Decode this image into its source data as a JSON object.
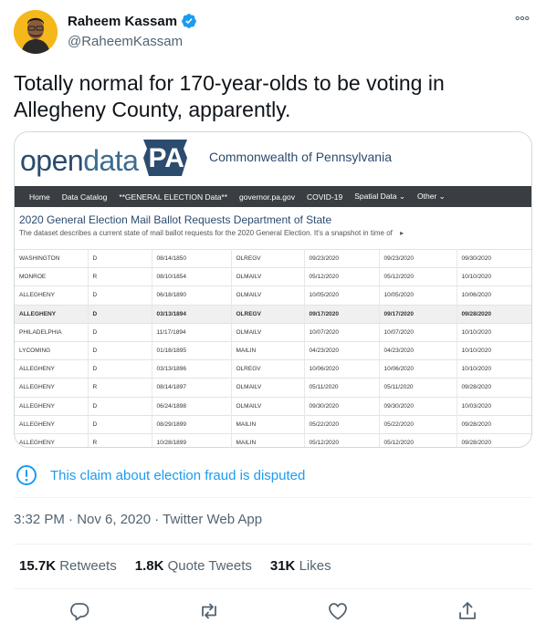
{
  "author": {
    "display_name": "Raheem Kassam",
    "handle": "@RaheemKassam"
  },
  "tweet": {
    "text": "Totally normal for 170-year-olds to be voting in Allegheny County, apparently."
  },
  "image": {
    "logo_open": "open",
    "logo_data": "data",
    "logo_pa": "PA",
    "commonwealth": "Commonwealth of Pennsylvania",
    "nav": [
      "Home",
      "Data Catalog",
      "**GENERAL ELECTION Data**",
      "governor.pa.gov",
      "COVID-19",
      "Spatial Data ⌄",
      "Other ⌄"
    ],
    "title": "2020 General Election Mail Ballot Requests Department of State",
    "description": "The dataset describes a current state of mail ballot requests for the 2020 General Election. It's a snapshot in time of",
    "rows": [
      [
        "WASHINGTON",
        "D",
        "08/14/1850",
        "OLREGV",
        "09/23/2020",
        "09/23/2020",
        "09/30/2020"
      ],
      [
        "MONROE",
        "R",
        "08/10/1854",
        "OLMAILV",
        "05/12/2020",
        "05/12/2020",
        "10/10/2020"
      ],
      [
        "ALLEGHENY",
        "D",
        "06/18/1890",
        "OLMAILV",
        "10/05/2020",
        "10/05/2020",
        "10/06/2020"
      ],
      [
        "ALLEGHENY",
        "D",
        "03/13/1894",
        "OLREGV",
        "09/17/2020",
        "09/17/2020",
        "09/28/2020"
      ],
      [
        "PHILADELPHIA",
        "D",
        "11/17/1894",
        "OLMAILV",
        "10/07/2020",
        "10/07/2020",
        "10/10/2020"
      ],
      [
        "LYCOMING",
        "D",
        "01/18/1895",
        "MAILIN",
        "04/23/2020",
        "04/23/2020",
        "10/10/2020"
      ],
      [
        "ALLEGHENY",
        "D",
        "03/13/1896",
        "OLREGV",
        "10/06/2020",
        "10/06/2020",
        "10/10/2020"
      ],
      [
        "ALLEGHENY",
        "R",
        "08/14/1897",
        "OLMAILV",
        "05/11/2020",
        "05/11/2020",
        "09/28/2020"
      ],
      [
        "ALLEGHENY",
        "D",
        "06/24/1898",
        "OLMAILV",
        "09/30/2020",
        "09/30/2020",
        "10/03/2020"
      ],
      [
        "ALLEGHENY",
        "D",
        "08/29/1899",
        "MAILIN",
        "05/22/2020",
        "05/22/2020",
        "09/28/2020"
      ],
      [
        "ALLEGHENY",
        "R",
        "10/28/1899",
        "MAILIN",
        "05/12/2020",
        "05/12/2020",
        "09/28/2020"
      ]
    ],
    "highlight_row": 3
  },
  "notice": {
    "text": "This claim about election fraud is disputed",
    "icon": "info-icon"
  },
  "meta": {
    "timestamp": "3:32 PM · Nov 6, 2020 · Twitter Web App"
  },
  "stats": {
    "retweets_count": "15.7K",
    "retweets_label": " Retweets",
    "quotes_count": "1.8K",
    "quotes_label": " Quote Tweets",
    "likes_count": "31K",
    "likes_label": " Likes"
  },
  "colors": {
    "accent": "#1d9bf0",
    "verified": "#1d9bf0",
    "secondary_text": "#536471"
  }
}
